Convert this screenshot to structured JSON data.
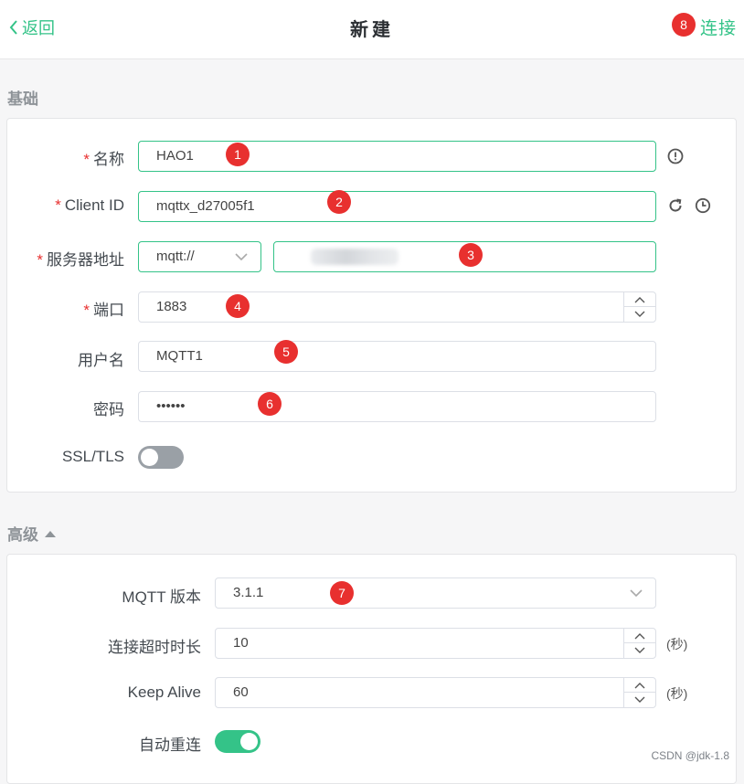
{
  "header": {
    "back_label": "返回",
    "title": "新建",
    "connect_label": "连接",
    "connect_badge": "8"
  },
  "basic": {
    "section_title": "基础",
    "name": {
      "label": "名称",
      "value": "HAO1",
      "badge": "1",
      "required": "*"
    },
    "client_id": {
      "label": "Client ID",
      "value": "mqttx_d27005f1",
      "badge": "2",
      "required": "*"
    },
    "server": {
      "label": "服务器地址",
      "protocol": "mqtt://",
      "host_value": "",
      "badge": "3",
      "required": "*"
    },
    "port": {
      "label": "端口",
      "value": "1883",
      "badge": "4",
      "required": "*"
    },
    "username": {
      "label": "用户名",
      "value": "MQTT1",
      "badge": "5"
    },
    "password": {
      "label": "密码",
      "value": "••••••",
      "badge": "6"
    },
    "ssl": {
      "label": "SSL/TLS",
      "enabled": false
    }
  },
  "advanced": {
    "section_title": "高级",
    "mqtt_version": {
      "label": "MQTT 版本",
      "value": "3.1.1",
      "badge": "7"
    },
    "connect_timeout": {
      "label": "连接超时时长",
      "value": "10",
      "unit": "(秒)"
    },
    "keep_alive": {
      "label": "Keep Alive",
      "value": "60",
      "unit": "(秒)"
    },
    "auto_reconnect": {
      "label": "自动重连",
      "enabled": true
    }
  },
  "watermark": "CSDN @jdk-1.8",
  "colors": {
    "accent": "#34c388",
    "badge": "#e8302f",
    "toggle_off": "#9aa0a6"
  }
}
